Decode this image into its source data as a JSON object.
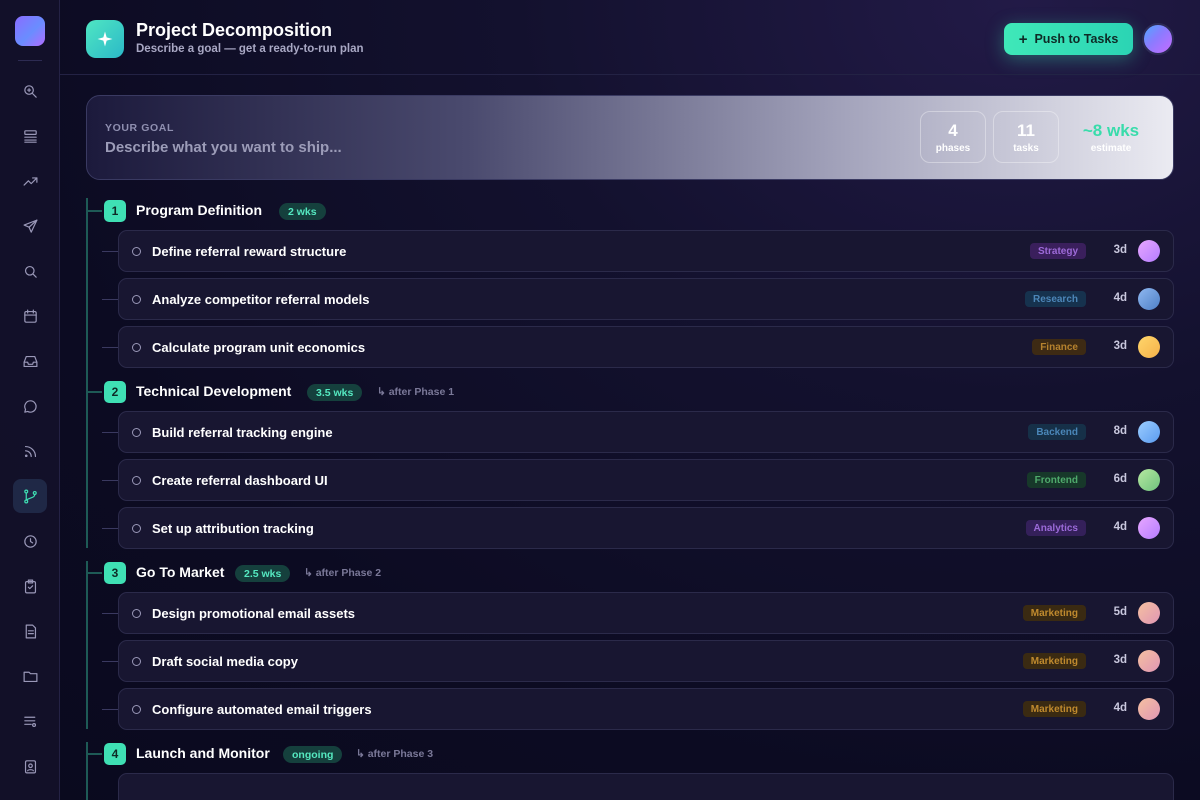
{
  "app": {
    "title": "Project Decomposition",
    "subtitle": "Describe a goal — get a ready-to-run plan",
    "push_label": "Push to Tasks"
  },
  "sidebar": {
    "items": [
      {
        "icon": "search-zoom-icon"
      },
      {
        "icon": "layers-icon"
      },
      {
        "icon": "trending-up-icon"
      },
      {
        "icon": "send-icon"
      },
      {
        "icon": "search-icon"
      },
      {
        "icon": "calendar-icon"
      },
      {
        "icon": "inbox-icon"
      },
      {
        "icon": "chat-icon"
      },
      {
        "icon": "rss-icon"
      },
      {
        "icon": "git-branch-icon",
        "active": true
      },
      {
        "icon": "clock-icon"
      },
      {
        "icon": "clipboard-check-icon"
      },
      {
        "icon": "document-icon"
      },
      {
        "icon": "folder-icon"
      },
      {
        "icon": "list-music-icon"
      },
      {
        "icon": "contact-badge-icon"
      }
    ]
  },
  "goal": {
    "label": "YOUR GOAL",
    "placeholder": "Describe what you want to ship..."
  },
  "stats": [
    {
      "value": "4",
      "label": "phases"
    },
    {
      "value": "11",
      "label": "tasks"
    },
    {
      "value": "~8 wks",
      "label": "estimate"
    }
  ],
  "colors": {
    "accent": "#3fe0b4",
    "background": "#0c0b22"
  },
  "phases": [
    {
      "number": "1",
      "title": "Program Definition",
      "duration": "2 wks",
      "dependency": "",
      "tasks": [
        {
          "title": "Define referral reward structure",
          "tag": "Strategy",
          "duration": "3d"
        },
        {
          "title": "Analyze competitor referral models",
          "tag": "Research",
          "duration": "4d"
        },
        {
          "title": "Calculate program unit economics",
          "tag": "Finance",
          "duration": "3d"
        }
      ]
    },
    {
      "number": "2",
      "title": "Technical Development",
      "duration": "3.5 wks",
      "dependency": "↳ after Phase 1",
      "tasks": [
        {
          "title": "Build referral tracking engine",
          "tag": "Backend",
          "duration": "8d"
        },
        {
          "title": "Create referral dashboard UI",
          "tag": "Frontend",
          "duration": "6d"
        },
        {
          "title": "Set up attribution tracking",
          "tag": "Analytics",
          "duration": "4d"
        }
      ]
    },
    {
      "number": "3",
      "title": "Go To Market",
      "duration": "2.5 wks",
      "dependency": "↳ after Phase 2",
      "tasks": [
        {
          "title": "Design promotional email assets",
          "tag": "Marketing",
          "duration": "5d"
        },
        {
          "title": "Draft social media copy",
          "tag": "Marketing",
          "duration": "3d"
        },
        {
          "title": "Configure automated email triggers",
          "tag": "Marketing",
          "duration": "4d"
        }
      ]
    },
    {
      "number": "4",
      "title": "Launch and Monitor",
      "duration": "ongoing",
      "dependency": "↳ after Phase 3",
      "tasks": []
    }
  ]
}
